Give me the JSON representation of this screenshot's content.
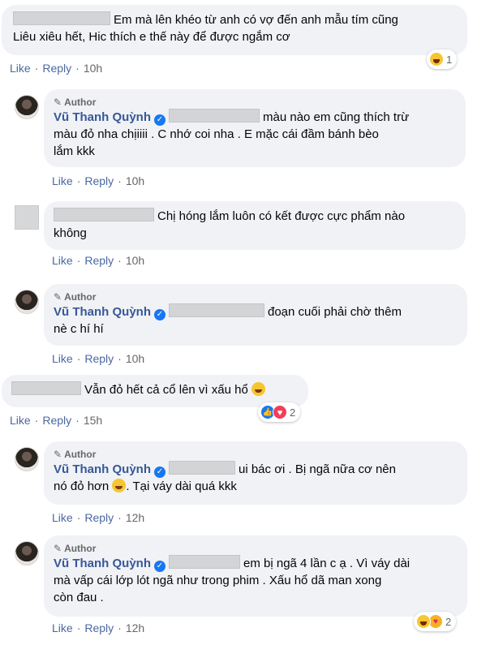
{
  "ui": {
    "like": "Like",
    "reply": "Reply",
    "author": "Author",
    "dot": "·",
    "verified_mark": "✓"
  },
  "comments": [
    {
      "text_a": "Em mà lên khéo từ anh có vợ đến anh mẫu tím cũng",
      "text_b": "Liêu xiêu hết, Hic thích e thế này để được ngắm cơ",
      "time": "10h",
      "reaction_count": "1"
    },
    {
      "author": "Vũ Thanh Quỳnh",
      "text_a": "màu nào em cũng thích trừ",
      "text_b": "màu đỏ nha chịiiii . C nhớ coi nha . E mặc cái đầm bánh bèo",
      "text_c": "lắm kkk",
      "time": "10h"
    },
    {
      "text_a": "Chị hóng lắm luôn có kết được cực phẩm nào",
      "text_b": "không",
      "time": "10h"
    },
    {
      "author": "Vũ Thanh Quỳnh",
      "text_a": "đoạn cuối phải chờ thêm",
      "text_b": "nè c hí hí",
      "time": "10h"
    },
    {
      "text_a": "Vẫn đỏ hết cả cổ lên vì xấu hổ",
      "time": "15h",
      "reaction_count": "2"
    },
    {
      "author": "Vũ Thanh Quỳnh",
      "text_a": "ui bác ơi . Bị ngã nữa cơ nên",
      "text_b": "nó đỏ hơn",
      "text_c": ". Tại váy dài quá kkk",
      "time": "12h"
    },
    {
      "author": "Vũ Thanh Quỳnh",
      "text_a": "em bị ngã 4 lần c ạ . Vì váy dài",
      "text_b": "mà vấp cái lớp lót ngã như trong phim . Xấu hổ dã man xong",
      "text_c": "còn đau .",
      "time": "12h",
      "reaction_count": "2"
    }
  ],
  "icons": {
    "avatar": "profile-photo",
    "author_badge": "pencil-icon",
    "verified": "verified-badge-icon",
    "emoji": "grinning-emoji-icon"
  },
  "colors": {
    "bubble": "#f0f2f5",
    "name": "#385898",
    "meta": "#65676b",
    "verified": "#1877f2"
  }
}
